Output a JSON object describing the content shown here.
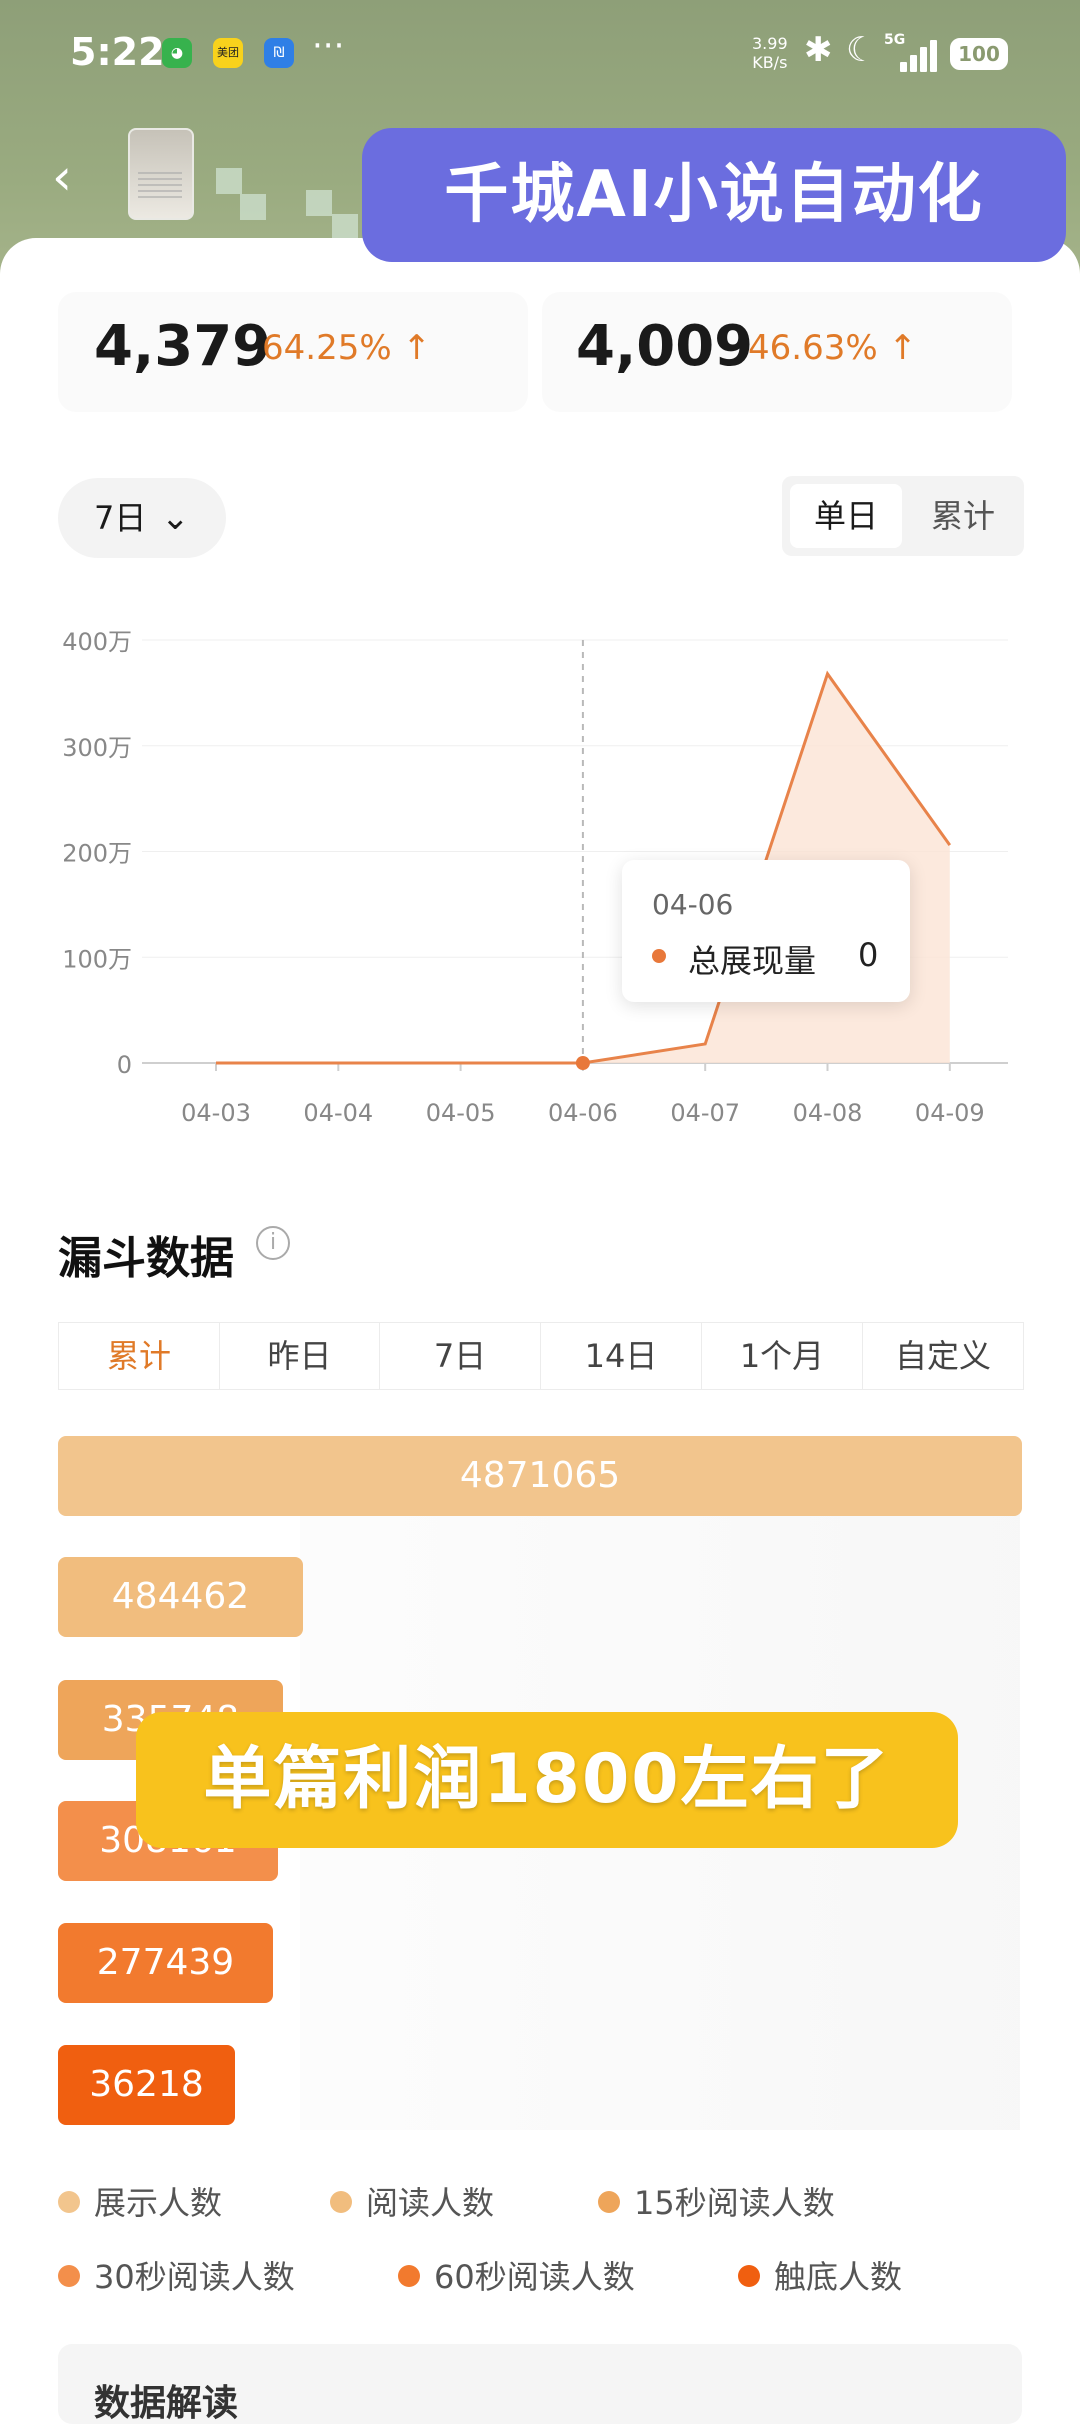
{
  "status_bar": {
    "time": "5:22",
    "net_speed": "3.99",
    "net_unit": "KB/s",
    "network": "5G",
    "battery": "100",
    "app_badge_1": "美团"
  },
  "overlay_banner": "千城AI小说自动化",
  "stats": [
    {
      "value": "4,379",
      "change": "64.25%"
    },
    {
      "value": "4,009",
      "change": "46.63%"
    }
  ],
  "range_select": {
    "label": "7日"
  },
  "mode_toggle": {
    "active": "单日",
    "other": "累计"
  },
  "chart_data": {
    "type": "area",
    "x": [
      "04-03",
      "04-04",
      "04-05",
      "04-06",
      "04-07",
      "04-08",
      "04-09"
    ],
    "series": [
      {
        "name": "总展现量",
        "values": [
          0,
          0,
          0,
          0,
          180000,
          3680000,
          2060000
        ]
      }
    ],
    "y_ticks": [
      "0",
      "100万",
      "200万",
      "300万",
      "400万"
    ],
    "ylim": [
      0,
      4000000
    ],
    "grid": true,
    "highlight_index": 3,
    "line_color": "#e8834a",
    "fill_color": "#fbe4d5"
  },
  "tooltip": {
    "date": "04-06",
    "label": "总展现量",
    "value": "0"
  },
  "funnel": {
    "title": "漏斗数据",
    "info_icon": "info-icon",
    "tabs": [
      "累计",
      "昨日",
      "7日",
      "14日",
      "1个月",
      "自定义"
    ],
    "active_tab": 0,
    "bars": [
      {
        "value": "4871065",
        "color": "#f2c58d",
        "share": 1.0
      },
      {
        "value": "484462",
        "color": "#f1bd7e",
        "share": 0.2545
      },
      {
        "value": "335748",
        "color": "#eea55a",
        "share": 0.2335
      },
      {
        "value": "308161",
        "color": "#f38f4b",
        "share": 0.2285
      },
      {
        "value": "277439",
        "color": "#f27a2e",
        "share": 0.2235
      },
      {
        "value": "36218",
        "color": "#f05f10",
        "share": 0.1835
      }
    ],
    "legend": [
      "展示人数",
      "阅读人数",
      "15秒阅读人数",
      "30秒阅读人数",
      "60秒阅读人数",
      "触底人数"
    ]
  },
  "overlay_sticker": "单篇利润1800左右了",
  "data_box": {
    "title": "数据解读"
  }
}
